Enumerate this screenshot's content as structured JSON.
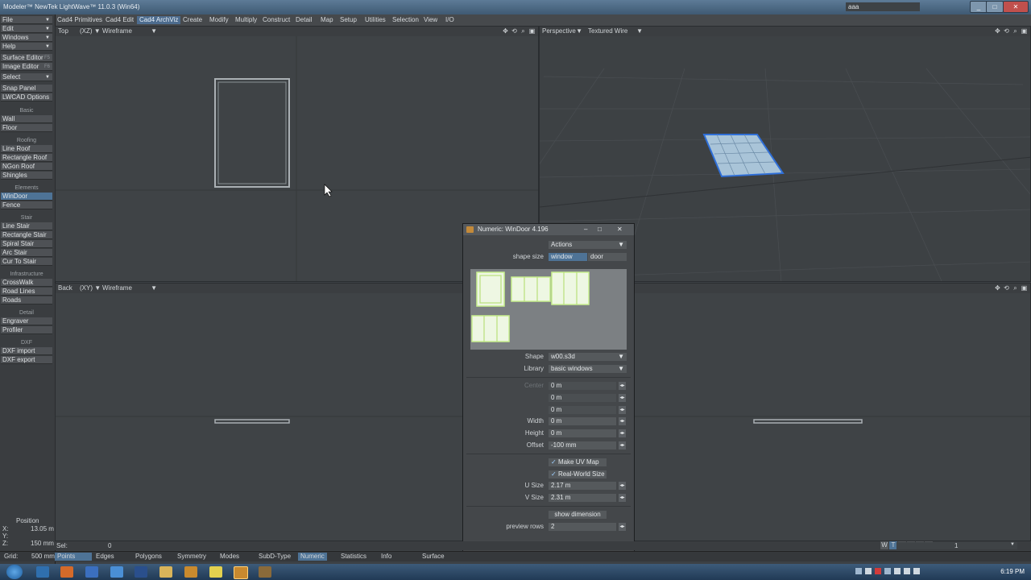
{
  "window": {
    "title": "Modeler™ NewTek LightWave™ 11.0.3 (Win64)",
    "search_text": "aaa"
  },
  "menu_tabs": [
    "Cad4 Primitives",
    "Cad4 Edit",
    "Cad4 ArchViz",
    "Create",
    "Modify",
    "Multiply",
    "Construct",
    "Detail",
    "Map",
    "Setup",
    "Utilities",
    "Selection",
    "View",
    "I/O"
  ],
  "menu_active": "Cad4 ArchViz",
  "left_menus": [
    "File",
    "Edit",
    "Windows",
    "Help"
  ],
  "left_tools": {
    "surface_editor": "Surface Editor",
    "surface_key": "F5",
    "image_editor": "Image Editor",
    "image_key": "F6",
    "select": "Select",
    "snap_panel": "Snap Panel",
    "lwcad_options": "LWCAD Options",
    "basic_head": "Basic",
    "wall": "Wall",
    "floor": "Floor",
    "roofing_head": "Roofing",
    "line_roof": "Line Roof",
    "rectangle_roof": "Rectangle Roof",
    "ngon_roof": "NGon Roof",
    "shingles": "Shingles",
    "elements_head": "Elements",
    "windoor": "WinDoor",
    "fence": "Fence",
    "stair_head": "Stair",
    "line_stair": "Line Stair",
    "rectangle_stair": "Rectangle Stair",
    "spiral_stair": "Spiral Stair",
    "arc_stair": "Arc Stair",
    "cur_to_stair": "Cur To Stair",
    "infra_head": "Infrastructure",
    "crosswalk": "CrossWalk",
    "road_lines": "Road Lines",
    "roads": "Roads",
    "detail_head": "Detail",
    "engraver": "Engraver",
    "profiler": "Profiler",
    "dxf_head": "DXF",
    "dxf_import": "DXF import",
    "dxf_export": "DXF export"
  },
  "viewports": {
    "top_left": {
      "view": "Top",
      "axes": "(XZ)",
      "mode": "Wireframe"
    },
    "top_right": {
      "view": "Perspective",
      "mode": "Textured Wire"
    },
    "bottom_left": {
      "view": "Back",
      "axes": "(XY)",
      "mode": "Wireframe"
    }
  },
  "dialog": {
    "title": "Numeric: WinDoor 4.196",
    "actions": "Actions",
    "shape_size_label": "shape size",
    "opt_window": "window",
    "opt_door": "door",
    "shape_label": "Shape",
    "shape_value": "w00.s3d",
    "library_label": "Library",
    "library_value": "basic windows",
    "center_label": "Center",
    "cx": "0 m",
    "cy": "0 m",
    "cz": "0 m",
    "width_label": "Width",
    "width_value": "0 m",
    "height_label": "Height",
    "height_value": "0 m",
    "offset_label": "Offset",
    "offset_value": "-100 mm",
    "make_uv_map": "Make UV Map",
    "real_world_size": "Real-World Size",
    "usize_label": "U Size",
    "usize_value": "2.17 m",
    "vsize_label": "V Size",
    "vsize_value": "2.31 m",
    "show_dimension": "show dimension",
    "preview_rows_label": "preview rows",
    "preview_rows_value": "2"
  },
  "position": {
    "label": "Position",
    "x_label": "X:",
    "x": "13.05 m",
    "y_label": "Y:",
    "z_label": "Z:",
    "z": "150 mm"
  },
  "status": {
    "sel_label": "Sel:",
    "sel_value": "0",
    "grid_label": "Grid:",
    "grid_value": "500 mm"
  },
  "modes": [
    "Points",
    "Edges",
    "Polygons",
    "Symmetry",
    "Modes",
    "SubD-Type",
    "Numeric",
    "Statistics",
    "Info",
    "Surface"
  ],
  "right_layers": [
    "W",
    "T",
    "M",
    "C",
    "S",
    "1"
  ],
  "layer_number": "1",
  "clock": "6:19 PM",
  "colors": {
    "accent": "#4e7396",
    "viewport_bg": "#3f4346",
    "window_green": "#d9f7b4",
    "poly_blue": "#2f6fd8"
  }
}
